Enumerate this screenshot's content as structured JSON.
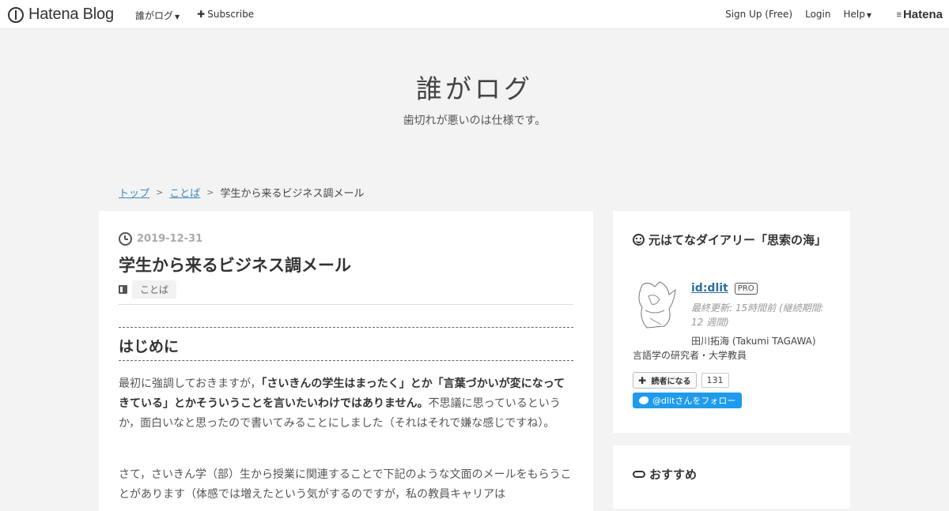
{
  "header": {
    "logo_text": "Hatena Blog",
    "blog_menu": "誰がログ",
    "subscribe": "Subscribe",
    "signup": "Sign Up (Free)",
    "login": "Login",
    "help": "Help",
    "hatena": "Hatena"
  },
  "blog": {
    "title": "誰がログ",
    "description": "歯切れが悪いのは仕様です。"
  },
  "breadcrumb": {
    "top": "トップ",
    "sep": ">",
    "category": "ことば",
    "current": "学生から来るビジネス調メール"
  },
  "article": {
    "date": "2019-12-31",
    "title": "学生から来るビジネス調メール",
    "category": "ことば",
    "section_heading": "はじめに",
    "p1_a": "最初に強調しておきますが，",
    "p1_b": "「さいきんの学生はまったく」とか「言葉づかいが変になってきている」とかそういうことを言いたいわけではありません。",
    "p1_c": "不思議に思っているというか，面白いなと思ったので書いてみることにしました（それはそれで嫌な感じですね）。",
    "p2": "さて，さいきん学（部）生から授業に関連することで下記のような文面のメールをもらうことがあります（体感では増えたという気がするのですが，私の教員キャリアは"
  },
  "sidebar": {
    "profile_title": "元はてなダイアリー「思索の海」",
    "user_id": "id:dlit",
    "pro_badge": "PRO",
    "last_update": "最終更新: 15時間前 (継続期間: 12 週間)",
    "real_name": "田川拓海 (Takumi TAGAWA)",
    "description": "言語学の研究者・大学教員",
    "reader_button": "読者になる",
    "reader_count": "131",
    "twitter_follow": "@dlitさんをフォロー",
    "recommend_title": "おすすめ"
  },
  "colors": {
    "link": "#3a8bbb",
    "twitter": "#1d9bf0"
  }
}
